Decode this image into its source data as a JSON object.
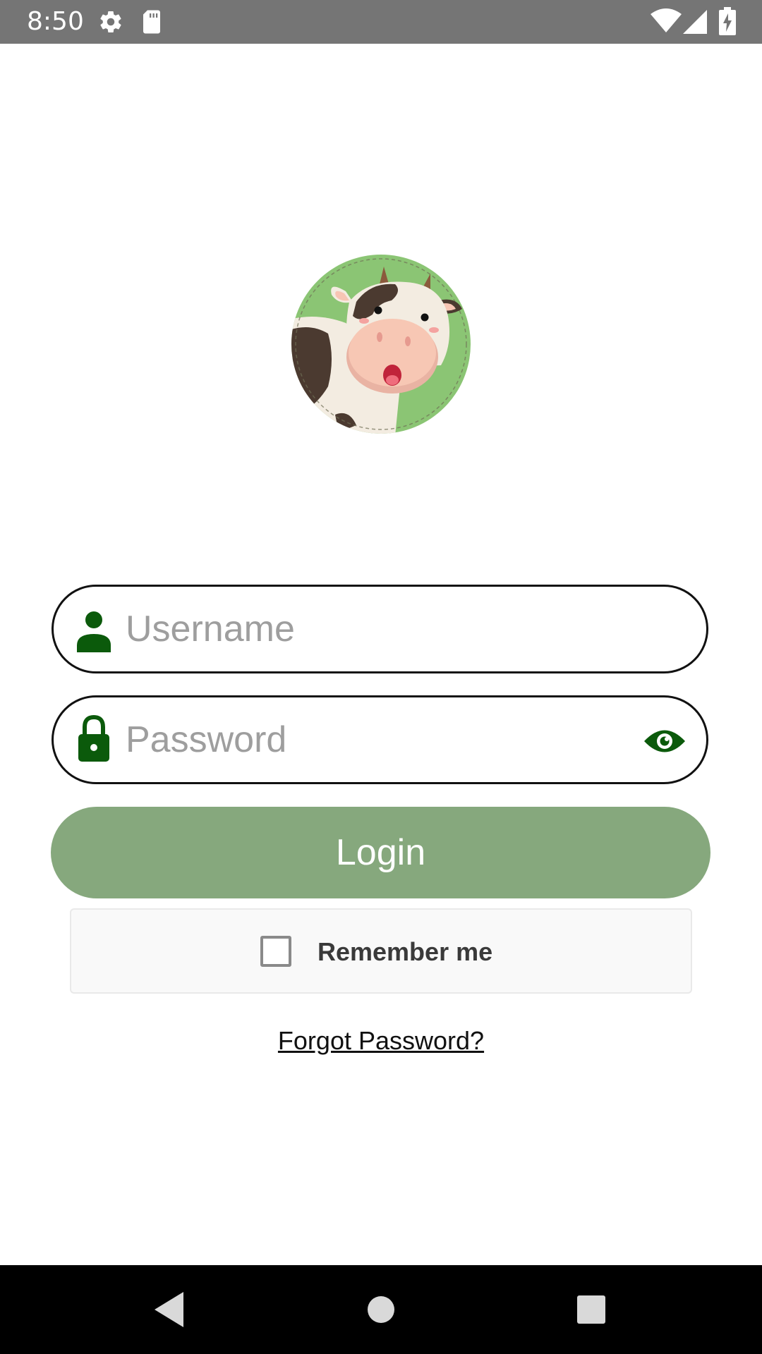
{
  "status_bar": {
    "time": "8:50",
    "icons": [
      "settings-icon",
      "sd-card-icon",
      "wifi-icon",
      "cell-signal-icon",
      "battery-charging-icon"
    ]
  },
  "logo": {
    "icon": "cow-mascot-logo"
  },
  "form": {
    "username": {
      "placeholder": "Username",
      "value": "",
      "icon": "person-icon"
    },
    "password": {
      "placeholder": "Password",
      "value": "",
      "icon": "lock-icon",
      "toggle_icon": "eye-icon"
    },
    "login_label": "Login",
    "remember_me": {
      "label": "Remember me",
      "checked": false
    },
    "forgot_password_label": "Forgot Password?"
  },
  "nav_bar": {
    "buttons": [
      "back-icon",
      "home-icon",
      "recents-icon"
    ]
  },
  "colors": {
    "primary_dark_green": "#0b5a0b",
    "login_button": "#86a87d",
    "status_bar": "#757575",
    "nav_bar": "#000000",
    "logo_green": "#8bc574"
  }
}
